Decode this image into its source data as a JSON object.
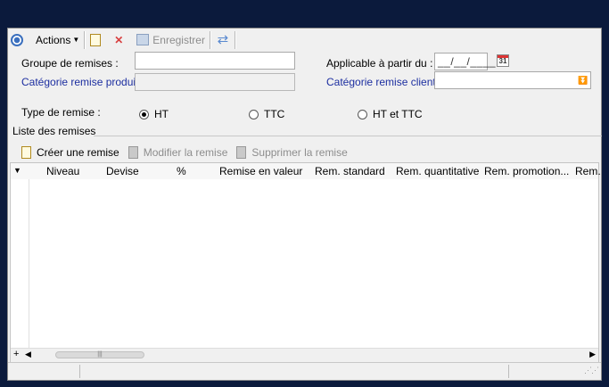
{
  "toolbar": {
    "actions_label": "Actions",
    "save_label": "Enregistrer"
  },
  "form": {
    "groupe_label": "Groupe de remises :",
    "groupe_value": "",
    "categorie_produit_label": "Catégorie remise produit :",
    "categorie_produit_value": "",
    "applicable_label": "Applicable à partir du :",
    "applicable_value": "__/__/____",
    "calendar_day": "31",
    "categorie_client_label": "Catégorie remise client :",
    "categorie_client_value": "",
    "type_label": "Type de remise :",
    "type_options": [
      "HT",
      "TTC",
      "HT et TTC"
    ],
    "type_selected": "HT"
  },
  "list": {
    "title": "Liste des remises",
    "create_label": "Créer une remise",
    "modify_label": "Modifier la remise",
    "delete_label": "Supprimer la remise",
    "columns": [
      "Niveau",
      "Devise",
      "%",
      "Remise en valeur",
      "Rem. standard",
      "Rem. quantitative",
      "Rem. promotion...",
      "Rem."
    ],
    "rows": [],
    "add_symbol": "+"
  },
  "colors": {
    "background": "#0b1a3c",
    "panel": "#f0f0f0",
    "link_label": "#1c2ea0"
  }
}
